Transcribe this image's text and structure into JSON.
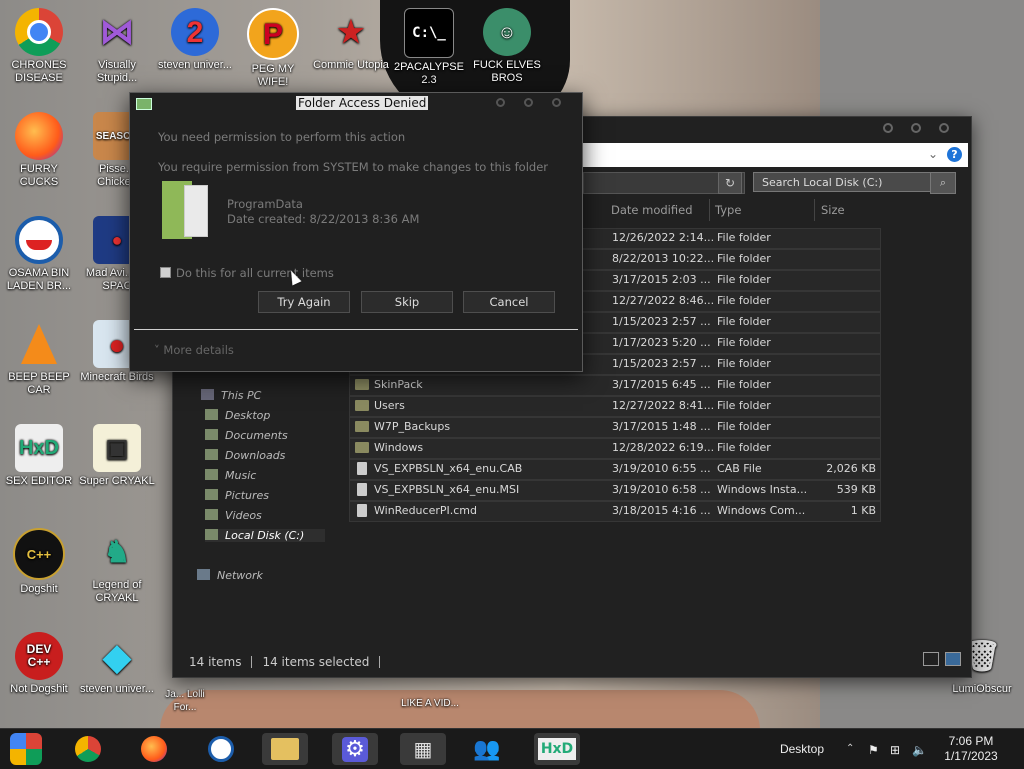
{
  "desktop": {
    "icons": [
      {
        "label": "CHRONES DISEASE",
        "icon": "chrome-icon"
      },
      {
        "label": "Visually Stupid...",
        "icon": "visual-studio-icon"
      },
      {
        "label": "steven univer...",
        "icon": "app-icon"
      },
      {
        "label": "PEG MY WIFE!",
        "icon": "p-logo-icon"
      },
      {
        "label": "Commie Utopia",
        "icon": "red-emblem-icon"
      },
      {
        "label": "2PACALYPSE 2.3",
        "icon": "cmd-icon"
      },
      {
        "label": "FUCK ELVES BROS",
        "icon": "elf-icon"
      },
      {
        "label": "FURRY CUCKS",
        "icon": "firefox-icon"
      },
      {
        "label": "Pisse... Chicken",
        "icon": "game-icon"
      },
      {
        "label": "OSAMA BIN LADEN BR...",
        "icon": "obama-logo-icon"
      },
      {
        "label": "Mad Avi... IN SPAC",
        "icon": "angry-birds-space-icon"
      },
      {
        "label": "BEEP BEEP CAR",
        "icon": "vlc-icon"
      },
      {
        "label": "Minecraft Birds",
        "icon": "angry-birds-icon"
      },
      {
        "label": "SEX EDITOR",
        "icon": "hxd-icon"
      },
      {
        "label": "Super CRYAKL",
        "icon": "pixel-cat-icon"
      },
      {
        "label": "Dogshit",
        "icon": "cpp-icon"
      },
      {
        "label": "Legend of CRYAKL",
        "icon": "pixel-hero-icon"
      },
      {
        "label": "Not Dogshit",
        "icon": "devcpp-icon"
      },
      {
        "label": "steven univer...",
        "icon": "diamond-icon"
      },
      {
        "label": "LumiObscur",
        "icon": "recycle-bin-icon"
      }
    ],
    "behind_text": [
      "Ja... Lolli For...",
      "LIKE A VID..."
    ]
  },
  "dialog": {
    "title": "Folder Access Denied",
    "line1": "You need permission to perform this action",
    "line2": "You require permission from SYSTEM to make changes to this folder",
    "item_name": "ProgramData",
    "item_date": "Date created: 8/22/2013 8:36 AM",
    "checkbox_label": "Do this for all current items",
    "buttons": {
      "try_again": "Try Again",
      "skip": "Skip",
      "cancel": "Cancel"
    },
    "more_details": "More details"
  },
  "explorer": {
    "search_placeholder": "Search Local Disk (C:)",
    "columns": {
      "date": "Date modified",
      "type": "Type",
      "size": "Size"
    },
    "rows": [
      {
        "name": "",
        "date": "12/26/2022 2:14...",
        "type": "File folder",
        "size": ""
      },
      {
        "name": "",
        "date": "8/22/2013 10:22...",
        "type": "File folder",
        "size": ""
      },
      {
        "name": "",
        "date": "3/17/2015 2:03 ...",
        "type": "File folder",
        "size": ""
      },
      {
        "name": "",
        "date": "12/27/2022 8:46...",
        "type": "File folder",
        "size": ""
      },
      {
        "name": "",
        "date": "1/15/2023 2:57 ...",
        "type": "File folder",
        "size": ""
      },
      {
        "name": "",
        "date": "1/17/2023 5:20 ...",
        "type": "File folder",
        "size": ""
      },
      {
        "name": "",
        "date": "1/15/2023 2:57 ...",
        "type": "File folder",
        "size": ""
      },
      {
        "name": "SkinPack",
        "date": "3/17/2015 6:45 ...",
        "type": "File folder",
        "size": ""
      },
      {
        "name": "Users",
        "date": "12/27/2022 8:41...",
        "type": "File folder",
        "size": ""
      },
      {
        "name": "W7P_Backups",
        "date": "3/17/2015 1:48 ...",
        "type": "File folder",
        "size": ""
      },
      {
        "name": "Windows",
        "date": "12/28/2022 6:19...",
        "type": "File folder",
        "size": ""
      },
      {
        "name": "VS_EXPBSLN_x64_enu.CAB",
        "date": "3/19/2010 6:55 ...",
        "type": "CAB File",
        "size": "2,026 KB"
      },
      {
        "name": "VS_EXPBSLN_x64_enu.MSI",
        "date": "3/19/2010 6:58 ...",
        "type": "Windows Insta...",
        "size": "539 KB"
      },
      {
        "name": "WinReducerPI.cmd",
        "date": "3/18/2015 4:16 ...",
        "type": "Windows Com...",
        "size": "1 KB"
      }
    ],
    "nav": {
      "this_pc": "This PC",
      "items": [
        "Desktop",
        "Documents",
        "Downloads",
        "Music",
        "Pictures",
        "Videos",
        "Local Disk (C:)"
      ],
      "network": "Network"
    },
    "status": {
      "count": "14 items",
      "selected": "14 items selected"
    }
  },
  "taskbar": {
    "desktop_label": "Desktop",
    "time": "7:06 PM",
    "date": "1/17/2023"
  }
}
